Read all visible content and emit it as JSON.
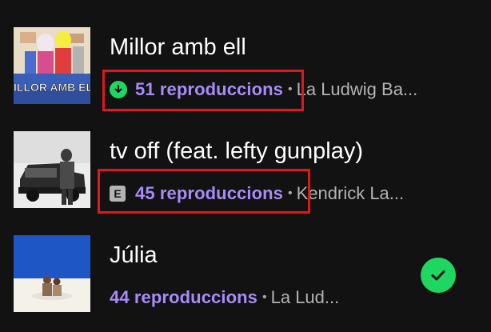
{
  "tracks": [
    {
      "title": "Millor amb ell",
      "plays": "51 reproduccions",
      "separator": "•",
      "artist": "La Ludwig Ba...",
      "cover_text": "MILLOR AMB ELL",
      "badge": "download-icon"
    },
    {
      "title": "tv off (feat. lefty gunplay)",
      "plays": "45 reproduccions",
      "separator": "•",
      "artist": "Kendrick La...",
      "badge": "explicit-icon",
      "badge_label": "E"
    },
    {
      "title": "Júlia",
      "plays": "44 reproduccions",
      "separator": "•",
      "artist": "La Lud...",
      "status": "check-icon"
    }
  ],
  "colors": {
    "background": "#121212",
    "plays": "#a78bfa",
    "accent_green": "#1ed760",
    "highlight": "#e0171f"
  }
}
